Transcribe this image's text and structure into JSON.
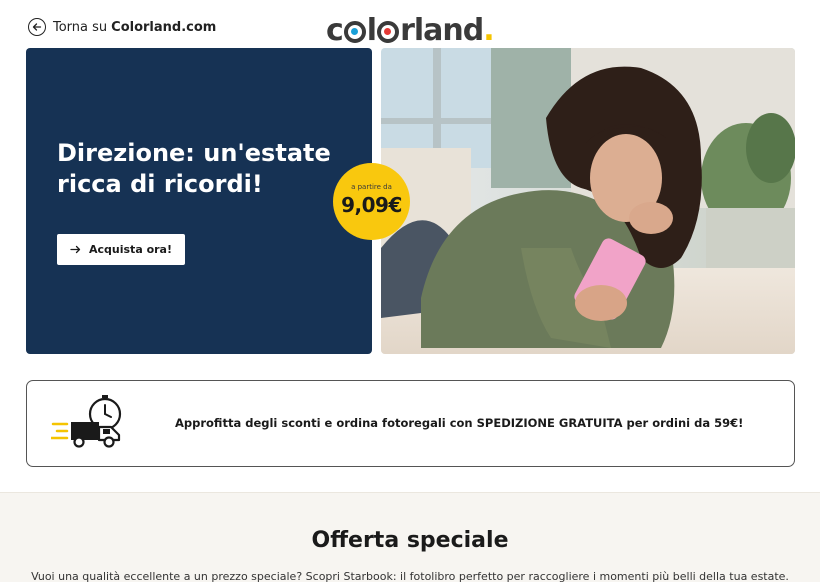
{
  "header": {
    "back_prefix": "Torna su",
    "back_brand": "Colorland.com",
    "back_icon": "arrow-left-circle-icon",
    "logo_text": "colorland."
  },
  "hero": {
    "title": "Direzione: un'estate ricca di ricordi!",
    "cta_label": "Acquista ora!",
    "cta_icon": "arrow-right-icon",
    "price_prefix": "a partire da",
    "price": "9,09€",
    "badge_color": "#f9c80e",
    "panel_color": "#163254",
    "photo": "woman-lying-on-bed-with-pink-phone"
  },
  "promo": {
    "icon": "delivery-truck-clock-icon",
    "text": "Approfitta degli sconti e ordina fotoregali con SPEDIZIONE GRATUITA per ordini da 59€!"
  },
  "special_offer": {
    "title": "Offerta speciale",
    "description": "Vuoi una qualità eccellente a un prezzo speciale? Scopri Starbook: il fotolibro perfetto per raccogliere i momenti più belli della tua estate."
  }
}
